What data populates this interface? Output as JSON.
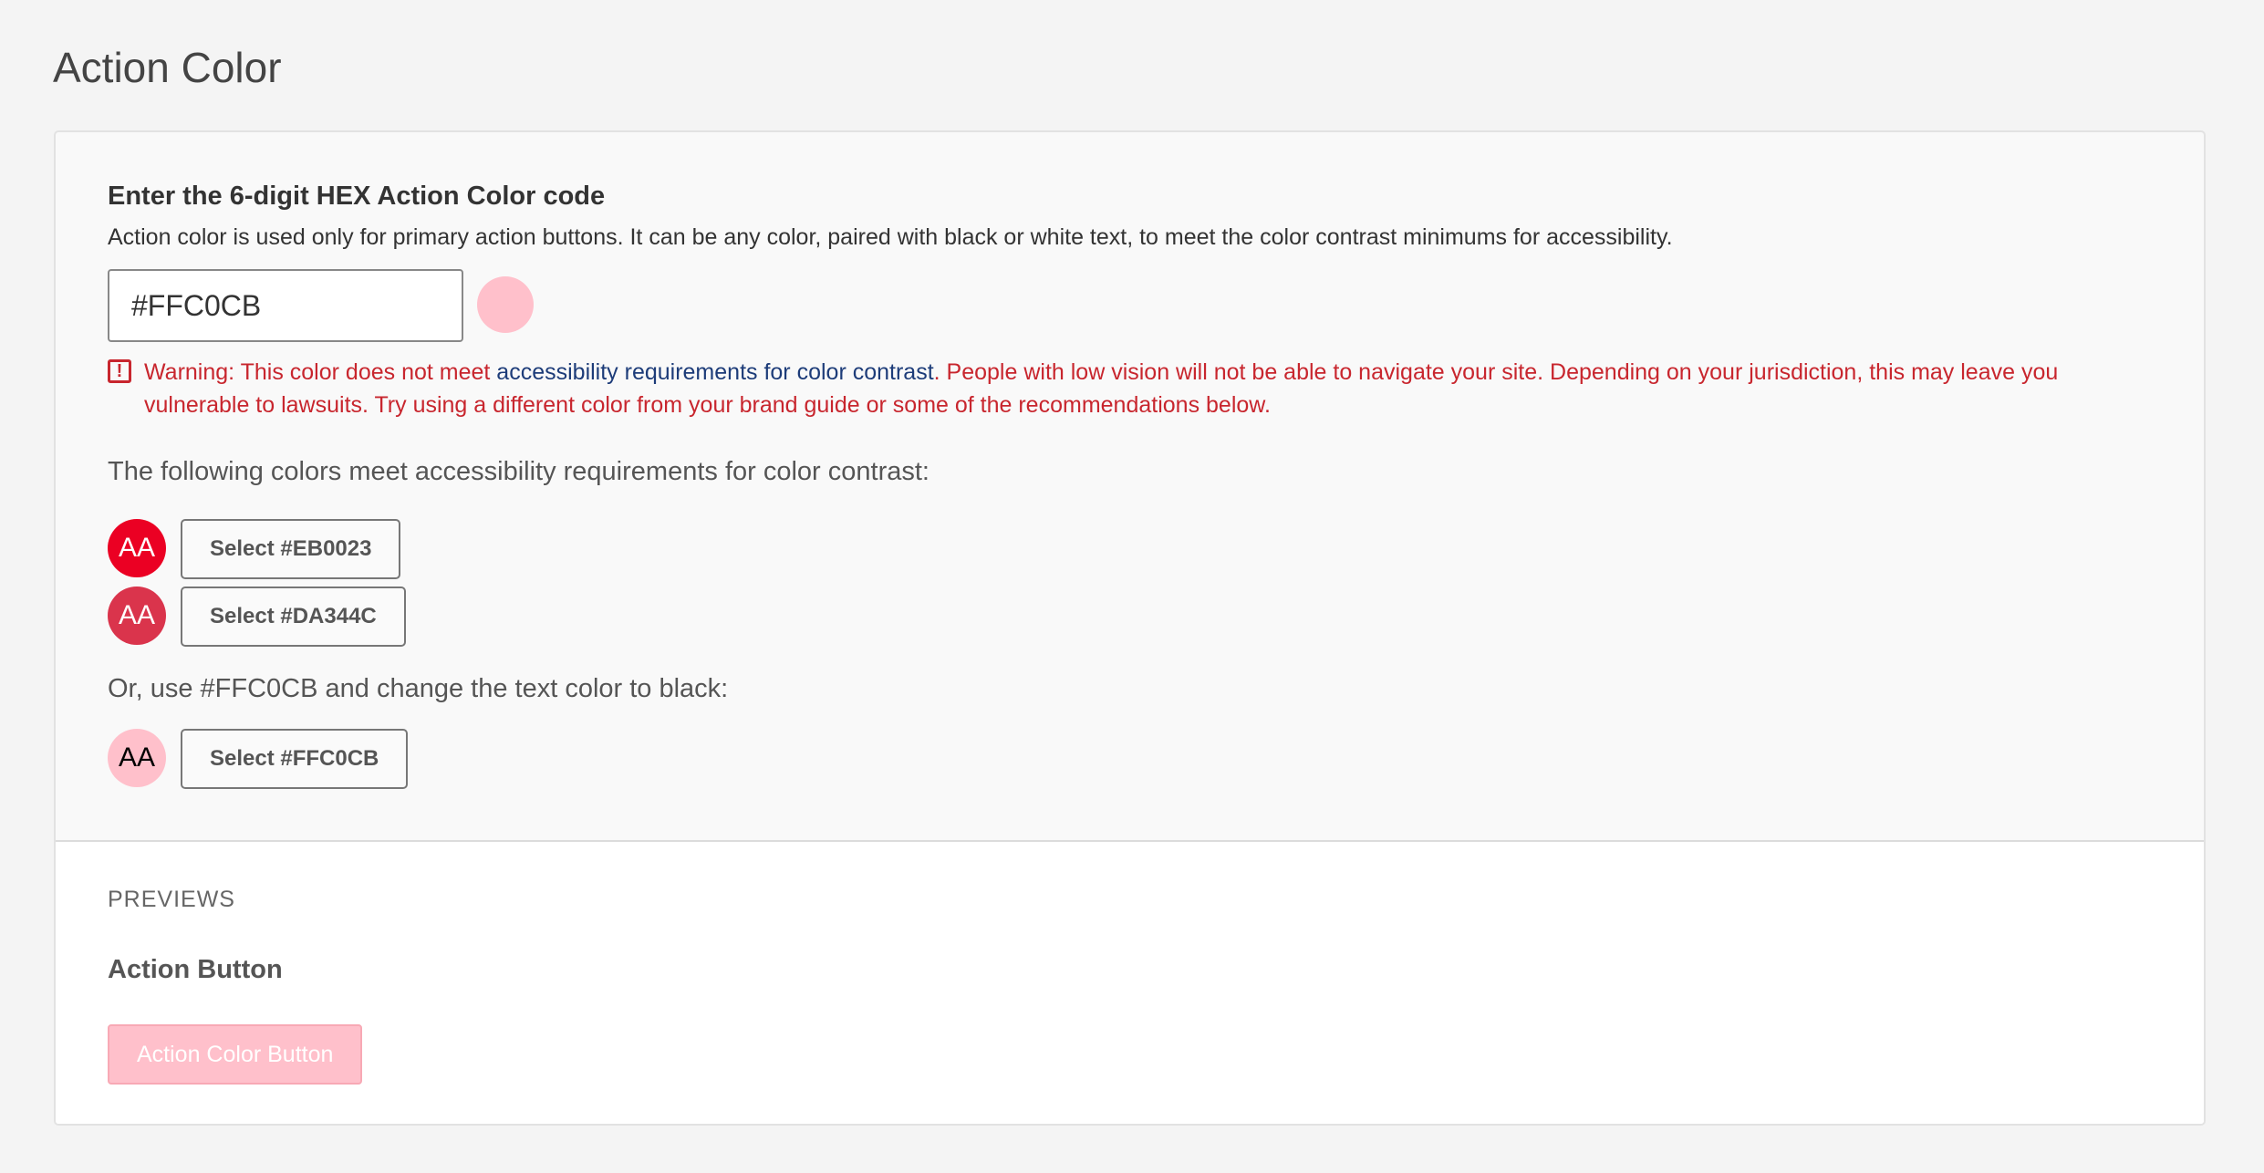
{
  "page": {
    "title": "Action Color"
  },
  "color_section": {
    "heading": "Enter the 6-digit HEX Action Color code",
    "description": "Action color is used only for primary action buttons. It can be any color, paired with black or white text, to meet the color contrast minimums for accessibility.",
    "hex_value": "#FFC0CB",
    "preview_color": "#FFC0CB"
  },
  "warning": {
    "icon": "alert-icon",
    "icon_glyph": "!",
    "prefix": "Warning: This color does not meet ",
    "link_text": "accessibility requirements for color contrast",
    "suffix": ". People with low vision will not be able to navigate your site. Depending on your jurisdiction, this may leave you vulnerable to lawsuits. Try using a different color from your brand guide or some of the recommendations below.",
    "color": "#C8262E",
    "link_color": "#1D3C79"
  },
  "recommendations": {
    "heading": "The following colors meet accessibility requirements for color contrast:",
    "options": [
      {
        "swatch_label": "AA",
        "color": "#EB0023",
        "text_color": "#FFFFFF",
        "button_label": "Select #EB0023"
      },
      {
        "swatch_label": "AA",
        "color": "#DA344C",
        "text_color": "#FFFFFF",
        "button_label": "Select #DA344C"
      }
    ],
    "alt_heading": "Or, use #FFC0CB and change the text color to black:",
    "alt_option": {
      "swatch_label": "AA",
      "color": "#FFC0CB",
      "text_color": "#000000",
      "button_label": "Select #FFC0CB"
    }
  },
  "previews": {
    "label": "PREVIEWS",
    "heading": "Action Button",
    "button_label": "Action Color Button",
    "button_color": "#FFC0CB",
    "button_text_color": "#FFFFFF"
  }
}
